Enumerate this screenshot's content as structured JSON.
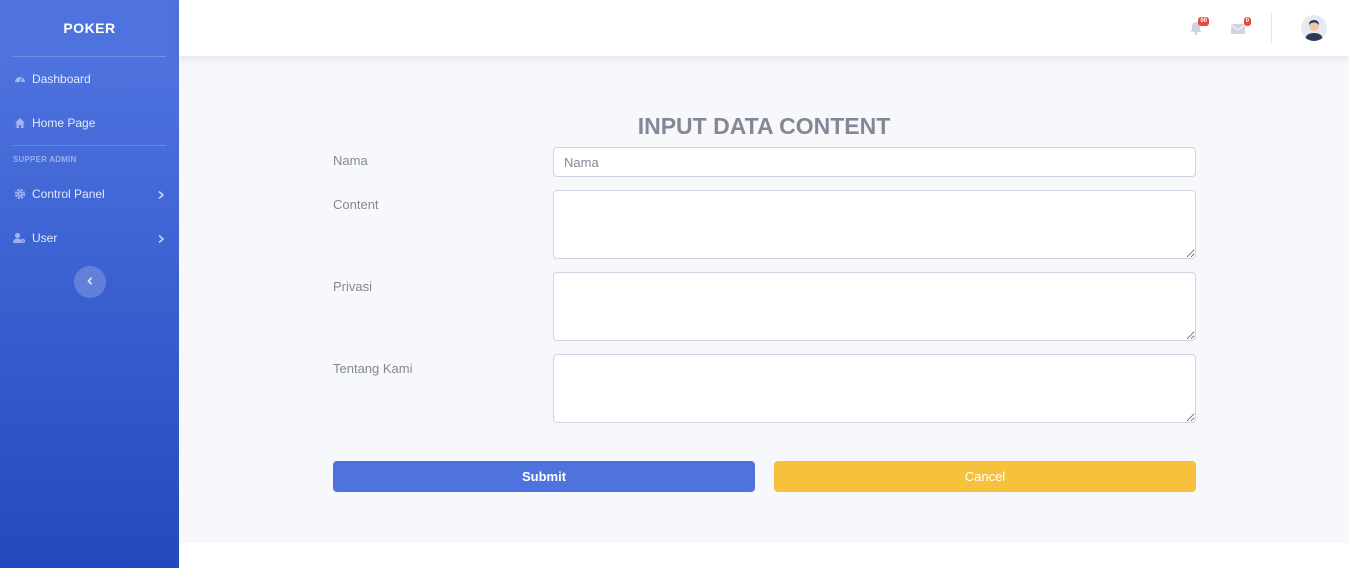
{
  "sidebar": {
    "brand": "POKER",
    "items": [
      {
        "label": "Dashboard",
        "icon": "dashboard-icon"
      },
      {
        "label": "Home Page",
        "icon": "home-icon"
      }
    ],
    "heading": "SUPPER ADMIN",
    "admin_items": [
      {
        "label": "Control Panel",
        "icon": "gear-icon"
      },
      {
        "label": "User",
        "icon": "user-cog-icon"
      }
    ]
  },
  "topbar": {
    "alerts_count": "00",
    "messages_count": "0"
  },
  "form": {
    "title": "INPUT DATA CONTENT",
    "fields": {
      "nama": {
        "label": "Nama",
        "placeholder": "Nama",
        "value": ""
      },
      "content": {
        "label": "Content",
        "value": ""
      },
      "privasi": {
        "label": "Privasi",
        "value": ""
      },
      "tentang": {
        "label": "Tentang Kami",
        "value": ""
      }
    },
    "submit_label": "Submit",
    "cancel_label": "Cancel"
  },
  "colors": {
    "primary": "#4e73df",
    "warning": "#f6c23e",
    "danger": "#e74a3b",
    "background": "#f7f8fc"
  }
}
